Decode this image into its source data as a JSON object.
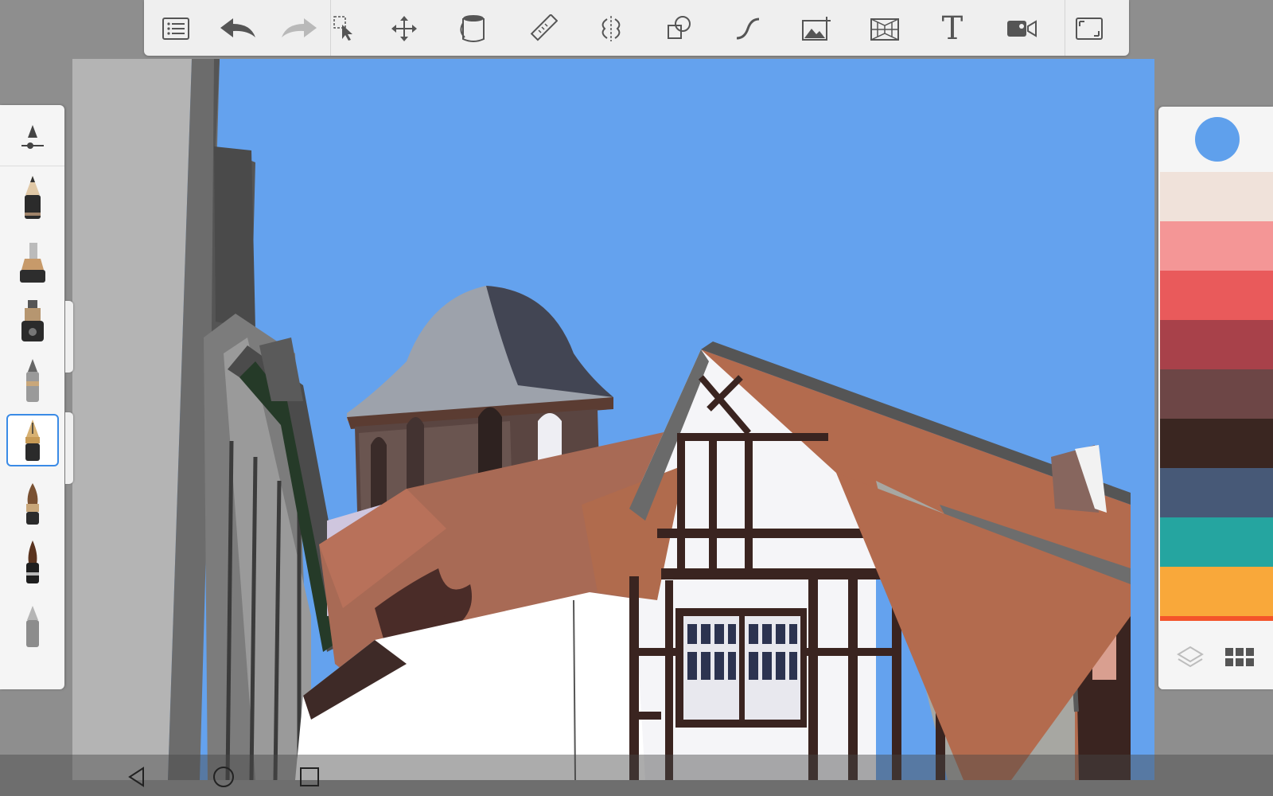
{
  "app": {
    "toolbar": {
      "items": [
        {
          "name": "layers-list-icon"
        },
        {
          "name": "undo-icon"
        },
        {
          "name": "redo-icon"
        },
        {
          "name": "selection-icon"
        },
        {
          "name": "transform-move-icon"
        },
        {
          "name": "fill-bucket-icon"
        },
        {
          "name": "ruler-icon"
        },
        {
          "name": "symmetry-icon"
        },
        {
          "name": "shapes-icon"
        },
        {
          "name": "curve-stroke-icon"
        },
        {
          "name": "add-image-icon"
        },
        {
          "name": "perspective-grid-icon"
        },
        {
          "name": "text-icon",
          "glyph": "T"
        },
        {
          "name": "time-lapse-record-icon"
        },
        {
          "name": "fullscreen-icon"
        }
      ]
    },
    "brush_panel": {
      "brushes": [
        {
          "name": "pencil-brush"
        },
        {
          "name": "marker-brush"
        },
        {
          "name": "airbrush-brush"
        },
        {
          "name": "ballpoint-brush"
        },
        {
          "name": "ink-pen-brush",
          "selected": true
        },
        {
          "name": "paintbrush-brush"
        },
        {
          "name": "ink-brush"
        },
        {
          "name": "eraser-brush"
        }
      ]
    },
    "color_panel": {
      "current_color": "#5fa0ec",
      "swatches": [
        "#f0e2da",
        "#f49696",
        "#e95a5b",
        "#a8414a",
        "#6d4646",
        "#3a2621",
        "#475977",
        "#25a5a0",
        "#f9a83a"
      ],
      "partial_swatch": "#f4542a"
    },
    "canvas": {
      "sky_color": "#64a2ee",
      "roof_color": "#b36b4e",
      "timber_color": "#3a2420"
    },
    "navbar": {
      "buttons": [
        {
          "name": "back-icon"
        },
        {
          "name": "home-icon"
        },
        {
          "name": "recents-icon"
        }
      ]
    }
  }
}
